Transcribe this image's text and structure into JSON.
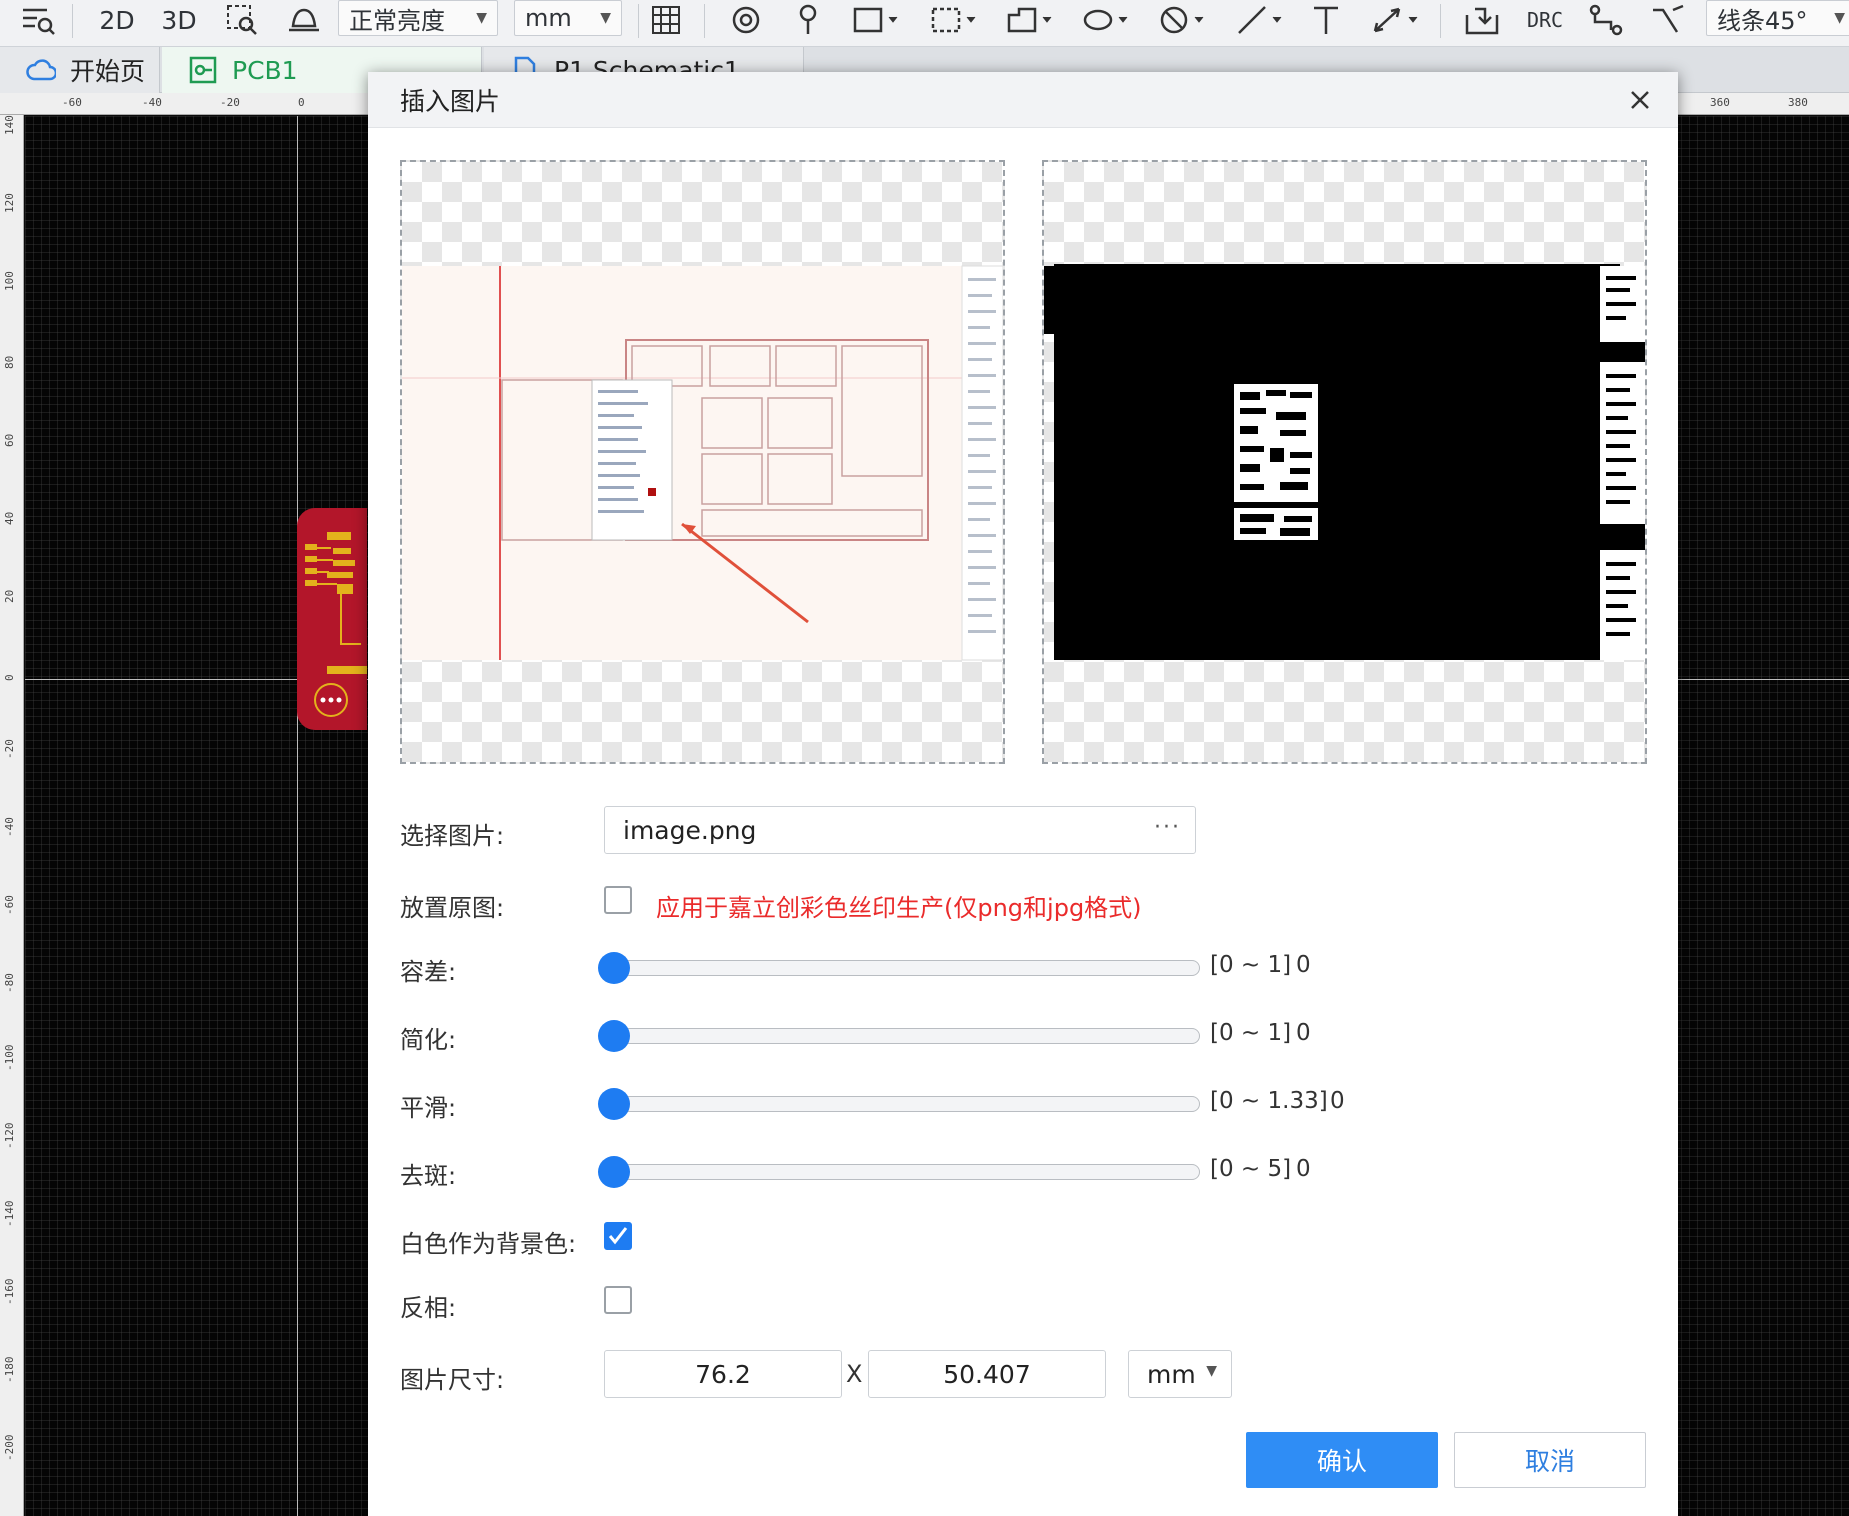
{
  "toolbar": {
    "view_2d": "2D",
    "view_3d": "3D",
    "brightness": "正常亮度",
    "units": "mm",
    "drc": "DRC",
    "line_mode": "线条45°"
  },
  "tabs": [
    {
      "label": "开始页"
    },
    {
      "label": "PCB1"
    },
    {
      "label": "P1.Schematic1"
    }
  ],
  "ruler_top": [
    "-60",
    "-40",
    "-20",
    "0",
    "360",
    "380"
  ],
  "ruler_left": [
    "140",
    "120",
    "100",
    "80",
    "60",
    "40",
    "20",
    "0",
    "-20",
    "-40",
    "-60",
    "-80",
    "-100",
    "-120",
    "-140",
    "-160",
    "-180",
    "-200"
  ],
  "dialog": {
    "title": "插入图片",
    "select_image_label": "选择图片:",
    "file_name": "image.png",
    "browse_dots": "···",
    "place_original_label": "放置原图:",
    "place_original_hint": "应用于嘉立创彩色丝印生产(仅png和jpg格式)",
    "place_original_checked": false,
    "sliders": [
      {
        "label": "容差:",
        "range": "[0 ~ 1]",
        "value": "0"
      },
      {
        "label": "简化:",
        "range": "[0 ~ 1]",
        "value": "0"
      },
      {
        "label": "平滑:",
        "range": "[0 ~ 1.33]",
        "value": "0"
      },
      {
        "label": "去斑:",
        "range": "[0 ~ 5]",
        "value": "0"
      }
    ],
    "white_bg_label": "白色作为背景色:",
    "white_bg_checked": true,
    "invert_label": "反相:",
    "invert_checked": false,
    "size_label": "图片尺寸:",
    "width": "76.2",
    "x_sep": "X",
    "height": "50.407",
    "size_unit": "mm",
    "ok_label": "确认",
    "cancel_label": "取消"
  },
  "colors": {
    "accent": "#2f8df5",
    "checkbox_checked": "#1e7cf2",
    "slider_thumb": "#1e7cf2",
    "hint_red": "#ea2b2b",
    "tab_active_green": "#1f9b52",
    "pcb_red": "#b3162a"
  }
}
